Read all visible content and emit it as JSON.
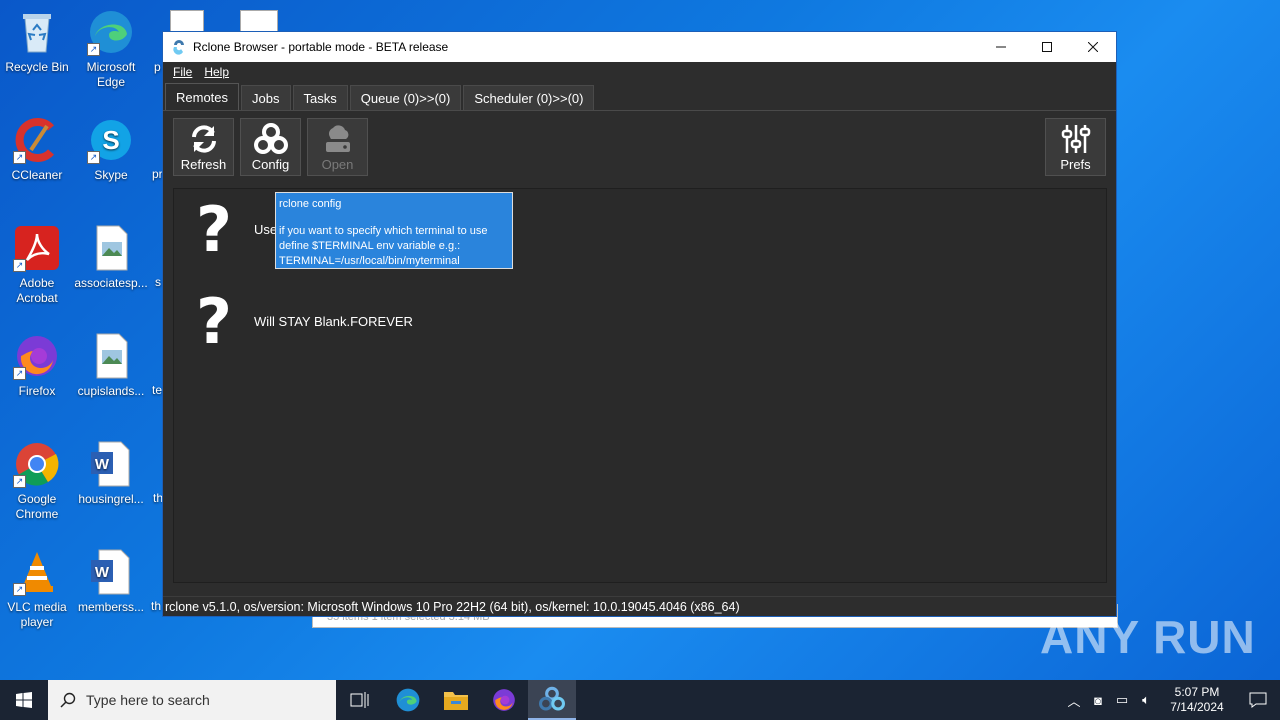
{
  "desktop": {
    "icons": [
      {
        "label": "Recycle Bin"
      },
      {
        "label": "Microsoft Edge"
      },
      {
        "label": "CCleaner"
      },
      {
        "label": "Skype"
      },
      {
        "label": "Adobe Acrobat"
      },
      {
        "label": "associatesp..."
      },
      {
        "label": "Firefox"
      },
      {
        "label": "cupislands..."
      },
      {
        "label": "Google Chrome"
      },
      {
        "label": "housingrel..."
      },
      {
        "label": "VLC media player"
      },
      {
        "label": "memberss..."
      }
    ],
    "partial_labels": [
      "p",
      "pr",
      "s",
      "te",
      "th",
      "th"
    ]
  },
  "explorer_fragment": {
    "text": "35 items     1 item selected  3.14 MB"
  },
  "window": {
    "title": "Rclone Browser - portable mode - BETA release",
    "menu": [
      "File",
      "Help"
    ],
    "tabs": [
      "Remotes",
      "Jobs",
      "Tasks",
      "Queue (0)>>(0)",
      "Scheduler (0)>>(0)"
    ],
    "active_tab": "Remotes",
    "toolbar": {
      "refresh": "Refresh",
      "config": "Config",
      "open": "Open",
      "prefs": "Prefs"
    },
    "remotes": [
      {
        "icon": "?",
        "label": "Use"
      },
      {
        "icon": "?",
        "label": "Will STAY Blank.FOREVER"
      }
    ],
    "tooltip": {
      "heading": "rclone config",
      "lines": [
        "if you want to specify which terminal to use",
        "define $TERMINAL env variable e.g.:",
        "TERMINAL=/usr/local/bin/myterminal"
      ]
    },
    "status": "rclone v5.1.0, os/version: Microsoft Windows 10 Pro 22H2 (64 bit), os/kernel: 10.0.19045.4046 (x86_64)"
  },
  "watermark": "ANY RUN",
  "taskbar": {
    "search_placeholder": "Type here to search",
    "time": "5:07 PM",
    "date": "7/14/2024"
  },
  "colors": {
    "accent": "#2a84dc",
    "window_bg": "#2d2d2d",
    "taskbar_bg": "#1b2433"
  }
}
